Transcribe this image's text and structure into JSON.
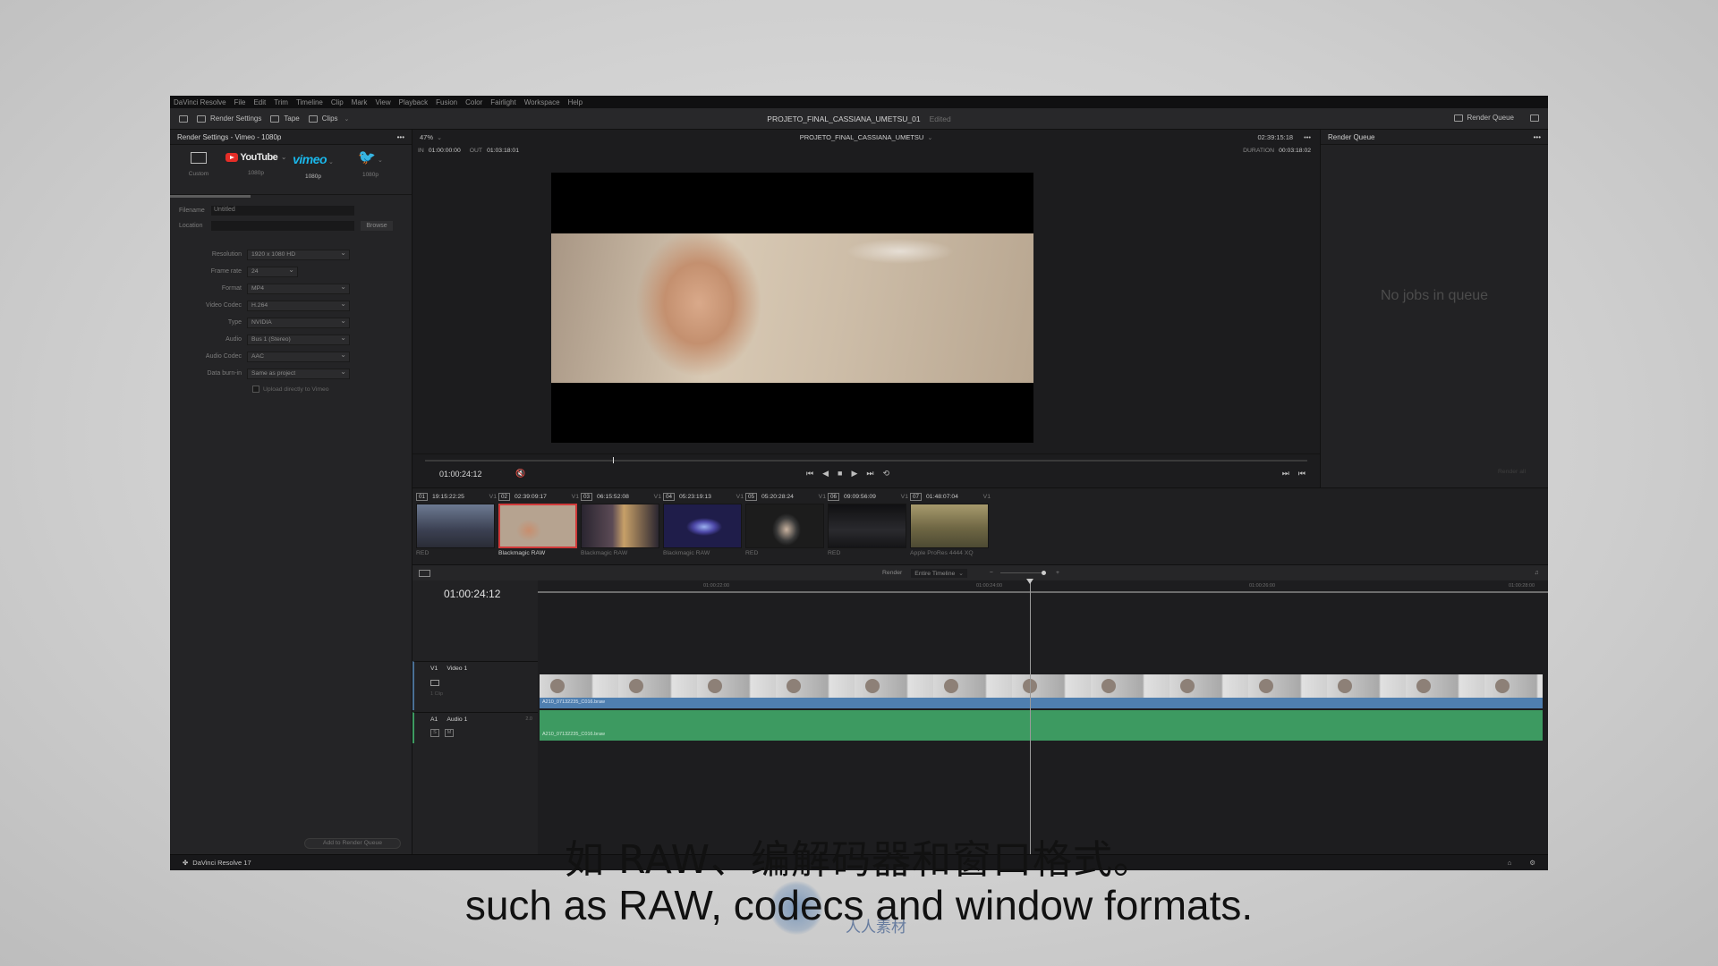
{
  "menu": [
    "DaVinci Resolve",
    "File",
    "Edit",
    "Trim",
    "Timeline",
    "Clip",
    "Mark",
    "View",
    "Playback",
    "Fusion",
    "Color",
    "Fairlight",
    "Workspace",
    "Help"
  ],
  "toolbar": {
    "render_settings": "Render Settings",
    "tape": "Tape",
    "clips": "Clips",
    "project_title": "PROJETO_FINAL_CASSIANA_UMETSU_01",
    "edited": "Edited",
    "render_queue": "Render Queue"
  },
  "left_panel": {
    "title": "Render Settings - Vimeo - 1080p",
    "presets": [
      {
        "name": "Custom",
        "sub": "Custom"
      },
      {
        "name": "YouTube",
        "sub": "1080p"
      },
      {
        "name": "vimeo",
        "sub": "1080p"
      },
      {
        "name": "Twitter",
        "sub": "1080p"
      }
    ],
    "filename_label": "Filename",
    "filename_value": "Untitled",
    "location_label": "Location",
    "browse": "Browse",
    "settings": [
      {
        "label": "Resolution",
        "value": "1920 x 1080 HD"
      },
      {
        "label": "Frame rate",
        "value": "24"
      },
      {
        "label": "Format",
        "value": "MP4"
      },
      {
        "label": "Video Codec",
        "value": "H.264"
      },
      {
        "label": "Type",
        "value": "NVIDIA"
      },
      {
        "label": "Audio",
        "value": "Bus 1 (Stereo)"
      },
      {
        "label": "Audio Codec",
        "value": "AAC"
      },
      {
        "label": "Data burn-in",
        "value": "Same as project"
      }
    ],
    "upload_label": "Upload directly to Vimeo",
    "add_to_queue": "Add to Render Queue"
  },
  "viewer": {
    "zoom": "47%",
    "timeline_name": "PROJETO_FINAL_CASSIANA_UMETSU",
    "timecode_top": "02:39:15:18",
    "in_label": "IN",
    "in_value": "01:00:00:00",
    "out_label": "OUT",
    "out_value": "01:03:18:01",
    "duration_label": "DURATION",
    "duration_value": "00:03:18:02",
    "current_tc": "01:00:24:12"
  },
  "queue": {
    "title": "Render Queue",
    "empty": "No jobs in queue",
    "render_all": "Render all"
  },
  "clips": [
    {
      "num": "01",
      "tc": "19:15:22:25",
      "track": "V1",
      "codec": "RED",
      "color": "#4a5366"
    },
    {
      "num": "02",
      "tc": "02:39:09:17",
      "track": "V1",
      "codec": "Blackmagic RAW",
      "color": "#b9a58f"
    },
    {
      "num": "03",
      "tc": "06:15:52:08",
      "track": "V1",
      "codec": "Blackmagic RAW",
      "color": "#3c3440"
    },
    {
      "num": "04",
      "tc": "05:23:19:13",
      "track": "V1",
      "codec": "Blackmagic RAW",
      "color": "#5a55a0"
    },
    {
      "num": "05",
      "tc": "05:20:28:24",
      "track": "V1",
      "codec": "RED",
      "color": "#3a3a3a"
    },
    {
      "num": "06",
      "tc": "09:09:56:09",
      "track": "V1",
      "codec": "RED",
      "color": "#1c1c1e"
    },
    {
      "num": "07",
      "tc": "01:48:07:04",
      "track": "V1",
      "codec": "Apple ProRes 4444 XQ",
      "color": "#8a7d55"
    }
  ],
  "timeline": {
    "render_label": "Render",
    "render_range": "Entire Timeline",
    "timecode": "01:00:24:12",
    "ruler_ticks": [
      "01:00:22:00",
      "01:00:24:00",
      "01:00:26:00",
      "01:00:28:00"
    ],
    "v1": "V1",
    "video_track": "Video 1",
    "video_clips": "1 Clip",
    "a1": "A1",
    "audio_track": "Audio 1",
    "audio_level": "2.0",
    "video_clip_name": "A210_07132235_C016.braw",
    "audio_clip_name": "A210_07132235_C016.braw"
  },
  "footer": {
    "app": "DaVinci Resolve 17"
  },
  "subtitles": {
    "cn": "如 RAW、编解码器和窗口格式。",
    "en": "such as RAW, codecs and window formats.",
    "watermark": "人人素材"
  }
}
